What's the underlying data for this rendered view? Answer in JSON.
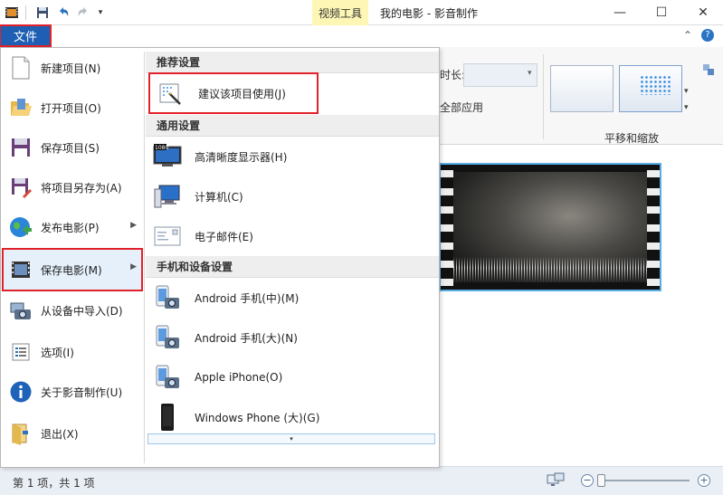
{
  "titlebar": {
    "context_tab": "视频工具",
    "window_title": "我的电影 - 影音制作",
    "minimize_glyph": "—",
    "maximize_glyph": "☐",
    "close_glyph": "✕"
  },
  "tabs": {
    "file_label": "文件"
  },
  "ribbon": {
    "duration_label": "时长:",
    "apply_all_label": "全部应用",
    "pan_zoom_group": "平移和缩放"
  },
  "file_menu": {
    "left_items": [
      {
        "label": "新建项目(N)",
        "icon": "new-document-icon",
        "has_submenu": false
      },
      {
        "label": "打开项目(O)",
        "icon": "open-folder-icon",
        "has_submenu": false
      },
      {
        "label": "保存项目(S)",
        "icon": "save-disk-icon",
        "has_submenu": false
      },
      {
        "label": "将项目另存为(A)",
        "icon": "save-as-icon",
        "has_submenu": false
      },
      {
        "label": "发布电影(P)",
        "icon": "globe-publish-icon",
        "has_submenu": true
      },
      {
        "label": "保存电影(M)",
        "icon": "film-save-icon",
        "has_submenu": true,
        "active": true
      },
      {
        "label": "从设备中导入(D)",
        "icon": "camera-import-icon",
        "has_submenu": false
      },
      {
        "label": "选项(I)",
        "icon": "options-list-icon",
        "has_submenu": false
      },
      {
        "label": "关于影音制作(U)",
        "icon": "info-icon",
        "has_submenu": false
      },
      {
        "label": "退出(X)",
        "icon": "exit-door-icon",
        "has_submenu": false
      }
    ],
    "sections": [
      {
        "header": "推荐设置",
        "items": [
          {
            "label": "建议该项目使用(J)",
            "icon": "recommended-wand-icon"
          }
        ]
      },
      {
        "header": "通用设置",
        "items": [
          {
            "label": "高清晰度显示器(H)",
            "icon": "hd-monitor-icon",
            "badge": "1080"
          },
          {
            "label": "计算机(C)",
            "icon": "computer-icon"
          },
          {
            "label": "电子邮件(E)",
            "icon": "email-icon"
          }
        ]
      },
      {
        "header": "手机和设备设置",
        "items": [
          {
            "label": "Android 手机(中)(M)",
            "icon": "android-phone-icon"
          },
          {
            "label": "Android 手机(大)(N)",
            "icon": "android-phone-large-icon"
          },
          {
            "label": "Apple iPhone(O)",
            "icon": "iphone-icon"
          },
          {
            "label": "Windows Phone (大)(G)",
            "icon": "windows-phone-icon"
          }
        ]
      }
    ],
    "more_glyph": "▾"
  },
  "status": {
    "text": "第 1 项，共 1 项",
    "zoom_minus": "−",
    "zoom_plus": "+"
  },
  "colors": {
    "file_tab": "#1e5fb4",
    "highlight_box": "#e2222a",
    "context_tab": "#fdf6b4",
    "film_border": "#5aaee6"
  }
}
